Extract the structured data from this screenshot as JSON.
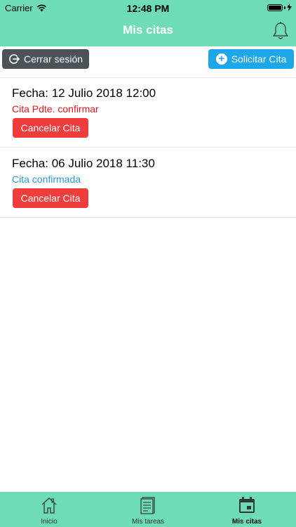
{
  "status_bar": {
    "carrier": "Carrier",
    "time": "12:48 PM",
    "battery_level": 1.0
  },
  "header": {
    "title": "Mis citas",
    "bell_icon": "bell-icon"
  },
  "toolbar": {
    "logout_label": "Cerrar sesión",
    "request_label": "Solicitar Cita"
  },
  "appointments": [
    {
      "date": "Fecha: 12 Julio 2018 12:00",
      "status": "Cita Pdte. confirmar",
      "status_color": "#e5161f",
      "cancel_label": "Cancelar Cita"
    },
    {
      "date": "Fecha: 06 Julio 2018 11:30",
      "status": "Cita confirmada",
      "status_color": "#2b97d5",
      "cancel_label": "Cancelar Cita"
    }
  ],
  "tabbar": {
    "items": [
      {
        "label": "Inicio",
        "icon": "home-icon"
      },
      {
        "label": "Mis tareas",
        "icon": "tasks-icon"
      },
      {
        "label": "Mis citas",
        "icon": "calendar-icon",
        "active": true
      }
    ]
  },
  "colors": {
    "accent": "#6ddcb7",
    "logout_btn": "#4c5358",
    "request_btn": "#1ea7e8",
    "cancel_btn": "#ef3c3c"
  }
}
